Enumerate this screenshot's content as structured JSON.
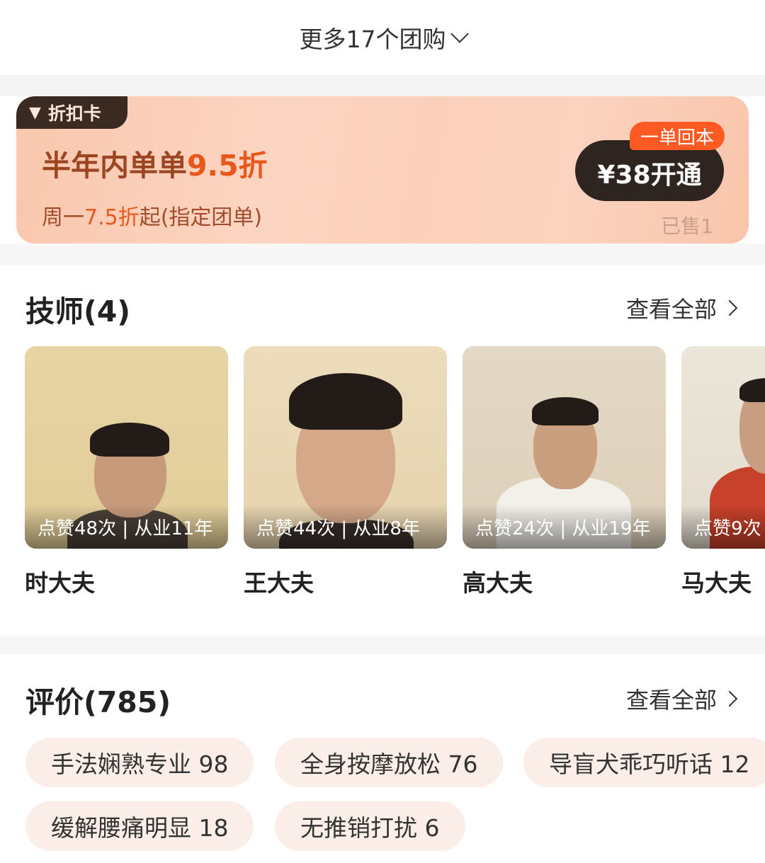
{
  "more_groupbuy": "更多17个团购",
  "discount_card": {
    "tag": "折扣卡",
    "headline_prefix": "半年内单单",
    "headline_value": "9.5折",
    "sub_prefix": "周一",
    "sub_value": "7.5折",
    "sub_suffix": "起(指定团单)",
    "badge": "一单回本",
    "button": "¥38开通",
    "sold": "已售1"
  },
  "technicians": {
    "title": "技师(4)",
    "see_all": "查看全部",
    "items": [
      {
        "name": "时大夫",
        "stats": "点赞48次 | 从业11年"
      },
      {
        "name": "王大夫",
        "stats": "点赞44次 | 从业8年"
      },
      {
        "name": "高大夫",
        "stats": "点赞24次 | 从业19年"
      },
      {
        "name": "马大夫",
        "stats": "点赞9次"
      }
    ]
  },
  "reviews": {
    "title": "评价(785)",
    "see_all": "查看全部",
    "tags": [
      "手法娴熟专业 98",
      "全身按摩放松 76",
      "导盲犬乖巧听话 12",
      "缓解腰痛明显 18",
      "无推销打扰 6"
    ]
  }
}
